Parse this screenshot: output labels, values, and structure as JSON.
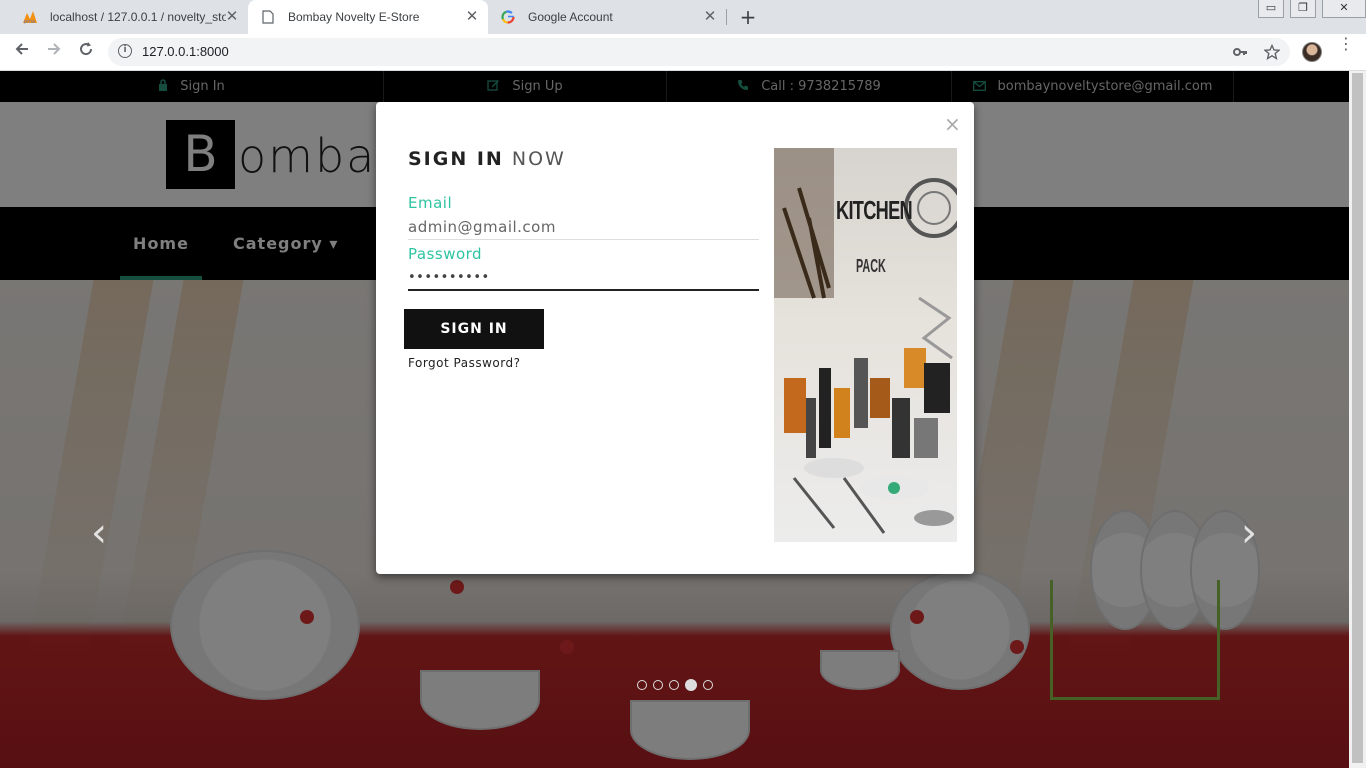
{
  "browser": {
    "tabs": [
      {
        "title": "localhost / 127.0.0.1 / novelty_sto",
        "favicon": "phpmyadmin-icon"
      },
      {
        "title": "Bombay Novelty E-Store",
        "favicon": "page-icon",
        "active": true
      },
      {
        "title": "Google Account",
        "favicon": "google-icon"
      }
    ],
    "new_tab": "+",
    "url": "127.0.0.1:8000",
    "window_buttons": {
      "minimize": "▭",
      "restore": "❐",
      "close": "✕"
    }
  },
  "topbar": {
    "items": [
      {
        "icon": "lock-icon",
        "label": "Sign In"
      },
      {
        "icon": "edit-icon",
        "label": "Sign Up"
      },
      {
        "icon": "phone-icon",
        "label": "Call : 9738215789"
      },
      {
        "icon": "envelope-icon",
        "label": "bombaynoveltystore@gmail.com"
      }
    ]
  },
  "header": {
    "logo_letter": "B",
    "logo_text": "ombay"
  },
  "nav": {
    "home": "Home",
    "category": "Category ▾"
  },
  "carousel": {
    "prev_icon": "‹",
    "next_icon": "›",
    "indicator_count": 5,
    "active_indicator": 4
  },
  "modal": {
    "close": "×",
    "title_strong": "SIGN IN",
    "title_light": "NOW",
    "email_label": "Email",
    "email_value": "admin@gmail.com",
    "password_label": "Password",
    "password_value": "••••••••••",
    "submit": "SIGN IN",
    "forgot": "Forgot Password?",
    "image_text_line1": "KITCHEN",
    "image_text_line2": "PACK"
  },
  "colors": {
    "accent": "#2ec4a1",
    "nav_underline": "#2a9d7f",
    "dark": "#000000"
  }
}
